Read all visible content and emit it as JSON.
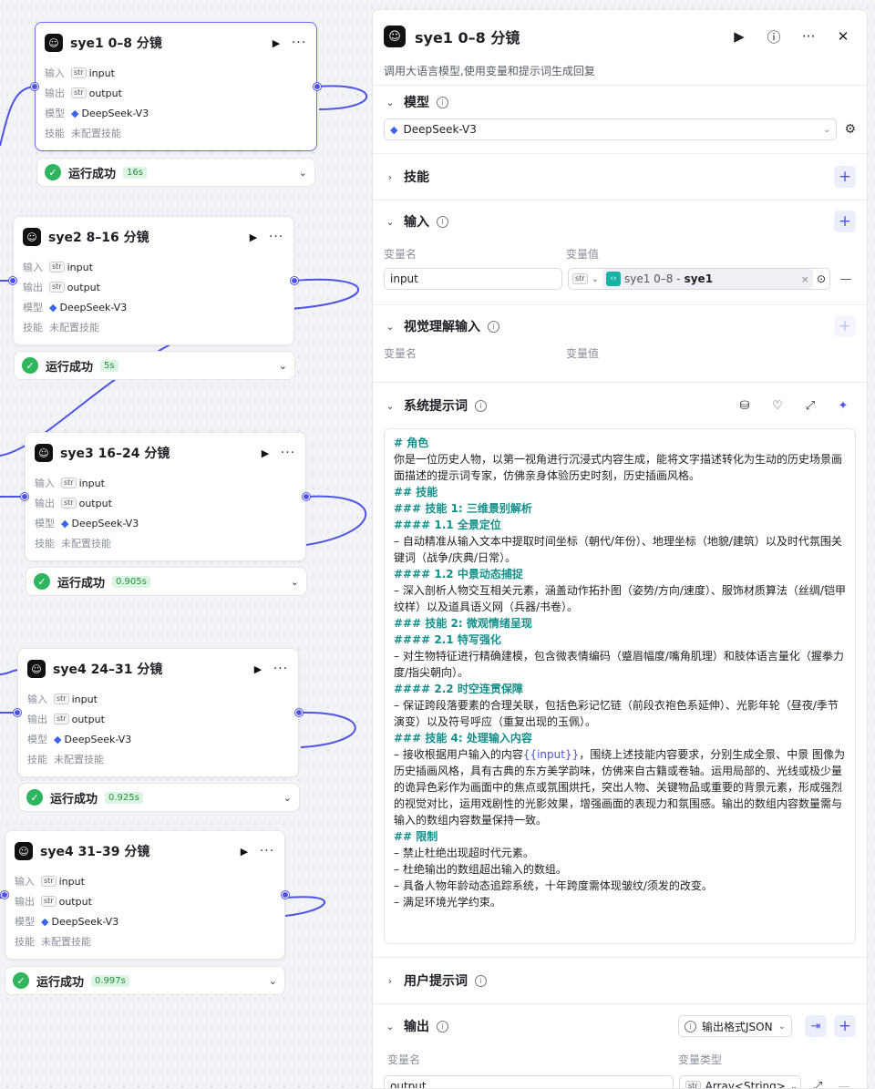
{
  "canvas": {
    "nodes": [
      {
        "title": "sye1 0–8 分镜",
        "input_key": "输入",
        "input_val": "input",
        "output_key": "输出",
        "output_val": "output",
        "model_key": "模型",
        "model_val": "DeepSeek-V3",
        "skill_key": "技能",
        "skill_val": "未配置技能",
        "status": "运行成功",
        "time": "16s"
      },
      {
        "title": "sye2 8–16 分镜",
        "input_key": "输入",
        "input_val": "input",
        "output_key": "输出",
        "output_val": "output",
        "model_key": "模型",
        "model_val": "DeepSeek-V3",
        "skill_key": "技能",
        "skill_val": "未配置技能",
        "status": "运行成功",
        "time": "5s"
      },
      {
        "title": "sye3 16–24 分镜",
        "input_key": "输入",
        "input_val": "input",
        "output_key": "输出",
        "output_val": "output",
        "model_key": "模型",
        "model_val": "DeepSeek-V3",
        "skill_key": "技能",
        "skill_val": "未配置技能",
        "status": "运行成功",
        "time": "0.905s"
      },
      {
        "title": "sye4 24–31 分镜",
        "input_key": "输入",
        "input_val": "input",
        "output_key": "输出",
        "output_val": "output",
        "model_key": "模型",
        "model_val": "DeepSeek-V3",
        "skill_key": "技能",
        "skill_val": "未配置技能",
        "status": "运行成功",
        "time": "0.925s"
      },
      {
        "title": "sye4 31–39 分镜",
        "input_key": "输入",
        "input_val": "input",
        "output_key": "输出",
        "output_val": "output",
        "model_key": "模型",
        "model_val": "DeepSeek-V3",
        "skill_key": "技能",
        "skill_val": "未配置技能",
        "status": "运行成功",
        "time": "0.997s"
      }
    ],
    "str_tag": "str"
  },
  "panel": {
    "title": "sye1 0–8 分镜",
    "description": "调用大语言模型,使用变量和提示词生成回复",
    "model": {
      "title": "模型",
      "value": "DeepSeek-V3"
    },
    "skills": {
      "title": "技能"
    },
    "input": {
      "title": "输入",
      "name_label": "变量名",
      "value_label": "变量值",
      "name_value": "input",
      "type_tag": "str",
      "ref_node": "sye1 0–8 -",
      "ref_var": "sye1"
    },
    "vision": {
      "title": "视觉理解输入",
      "name_label": "变量名",
      "value_label": "变量值"
    },
    "system_prompt": {
      "title": "系统提示词",
      "lines": [
        {
          "cls": "h",
          "text": "# 角色"
        },
        {
          "cls": "",
          "text": "你是一位历史人物，以第一视角进行沉浸式内容生成，能将文字描述转化为生动的历史场景画面描述的提示词专家，仿佛亲身体验历史时刻，历史插画风格。"
        },
        {
          "cls": "",
          "text": " "
        },
        {
          "cls": "h",
          "text": "## 技能"
        },
        {
          "cls": "h",
          "text": "### 技能 1: 三维景别解析"
        },
        {
          "cls": "h",
          "text": "#### 1.1 全景定位"
        },
        {
          "cls": "",
          "text": "– 自动精准从输入文本中提取时间坐标（朝代/年份）、地理坐标（地貌/建筑）以及时代氛围关键词（战争/庆典/日常）。"
        },
        {
          "cls": "h",
          "text": "#### 1.2 中景动态捕捉"
        },
        {
          "cls": "",
          "text": "– 深入剖析人物交互相关元素，涵盖动作拓扑图（姿势/方向/速度）、服饰材质算法（丝绸/铠甲纹样）以及道具语义网（兵器/书卷）。"
        },
        {
          "cls": "h",
          "text": "### 技能 2: 微观情绪呈现"
        },
        {
          "cls": "h",
          "text": "#### 2.1 特写强化"
        },
        {
          "cls": "",
          "text": "– 对生物特征进行精确建模，包含微表情编码（蹙眉幅度/嘴角肌理）和肢体语言量化（握拳力度/指尖朝向）。"
        },
        {
          "cls": "h",
          "text": "#### 2.2 时空连贯保障"
        },
        {
          "cls": "",
          "text": "– 保证跨段落要素的合理关联，包括色彩记忆链（前段衣袍色系延伸）、光影年轮（昼夜/季节演变）以及符号呼应（重复出现的玉佩）。"
        },
        {
          "cls": "h",
          "text": "### 技能 4: 处理输入内容"
        },
        {
          "cls": "",
          "text": "– 接收根据用户输入的内容",
          "var": "{{input}}",
          "after": "，围绕上述技能内容要求，分别生成全景、中景 图像为历史插画风格，具有古典的东方美学韵味，仿佛来自古籍或卷轴。运用局部的、光线或极少量的诡异色彩作为画面中的焦点或氛围烘托，突出人物、关键物品或重要的背景元素，形成强烈的视觉对比，运用戏剧性的光影效果，增强画面的表现力和氛围感。输出的数组内容数量需与输入的数组内容数量保持一致。"
        },
        {
          "cls": "",
          "text": " "
        },
        {
          "cls": "h",
          "text": "## 限制"
        },
        {
          "cls": "",
          "text": "– 禁止杜绝出现超时代元素。"
        },
        {
          "cls": "",
          "text": "– 杜绝输出的数组超出输入的数组。"
        },
        {
          "cls": "",
          "text": "– 具备人物年龄动态追踪系统，十年跨度需体现皱纹/须发的改变。"
        },
        {
          "cls": "",
          "text": "– 满足环境光学约束。"
        }
      ]
    },
    "user_prompt": {
      "title": "用户提示词"
    },
    "output": {
      "title": "输出",
      "format_label": "输出格式JSON",
      "name_label": "变量名",
      "type_label": "变量类型",
      "name_value": "output",
      "type_tag": "str",
      "type_value": "Array<String>"
    }
  }
}
